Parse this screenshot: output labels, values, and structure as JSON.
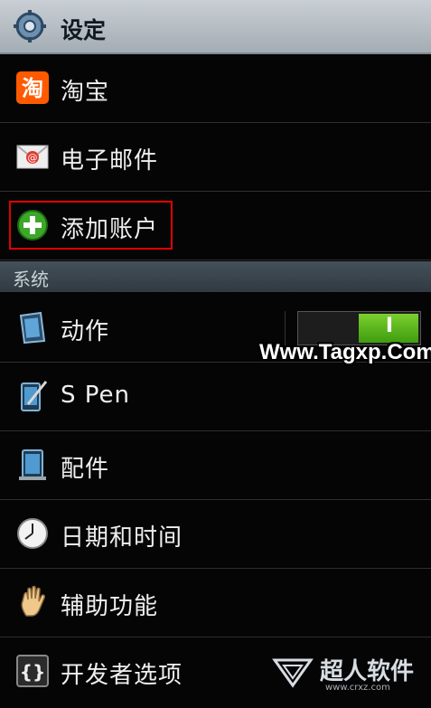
{
  "header": {
    "title": "设定",
    "icon": "gear-icon"
  },
  "accounts": [
    {
      "label": "淘宝",
      "icon": "taobao-icon"
    },
    {
      "label": "电子邮件",
      "icon": "email-icon"
    },
    {
      "label": "添加账户",
      "icon": "add-account-icon"
    }
  ],
  "section": {
    "label": "系统"
  },
  "system": [
    {
      "label": "动作",
      "icon": "motion-icon",
      "toggle": "I"
    },
    {
      "label": "S Pen",
      "icon": "s-pen-icon"
    },
    {
      "label": "配件",
      "icon": "accessory-icon"
    },
    {
      "label": "日期和时间",
      "icon": "clock-icon"
    },
    {
      "label": "辅助功能",
      "icon": "hand-icon"
    },
    {
      "label": "开发者选项",
      "icon": "developer-icon"
    }
  ],
  "watermark": {
    "text": "Www.Tagxp.Com"
  },
  "brand": {
    "name": "超人软件",
    "url": "www.crxz.com"
  },
  "colors": {
    "header_bg": "#b6bec5",
    "accent_green": "#5cb820",
    "highlight_red": "#e00000",
    "section_bg": "#3a444c"
  }
}
